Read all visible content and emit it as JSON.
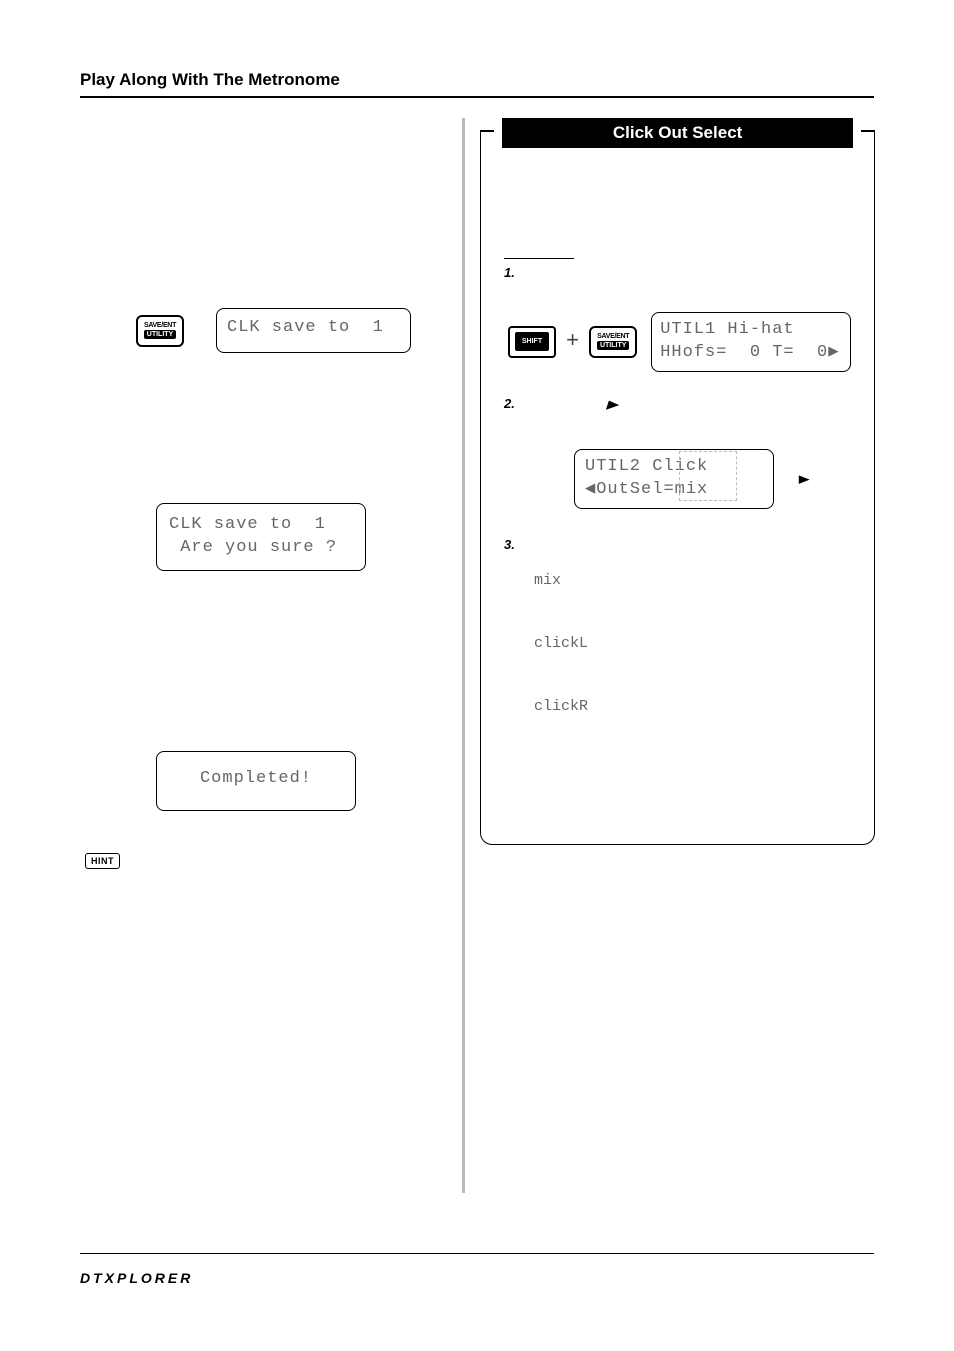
{
  "pageTitle": "Play Along With The Metronome",
  "left": {
    "keySaveEntTop": "SAVE/ENT",
    "keySaveEntBot": "UTILITY",
    "lcd1": "CLK save to  1",
    "lcd2_line1": "CLK save to  1",
    "lcd2_line2": " Are you sure ?",
    "lcd3": "Completed!",
    "hint": "HINT"
  },
  "right": {
    "header": "Click Out Select",
    "step1": "1.",
    "keyShift": "SHIFT",
    "keySaveEntTop": "SAVE/ENT",
    "keySaveEntBot": "UTILITY",
    "utilLcd_line1": "UTIL1 Hi-hat",
    "utilLcd_line2": "HHofs=  0 T=  0▶",
    "step2": "2.",
    "step2arrow": "▶",
    "util2_line1": "UTIL2 Click",
    "util2_line2": "◀OutSel=mix",
    "arrowOut": "▶",
    "step3": "3.",
    "opts": [
      "mix",
      "clickL",
      "clickR"
    ]
  },
  "brand": "DTXPLORER"
}
